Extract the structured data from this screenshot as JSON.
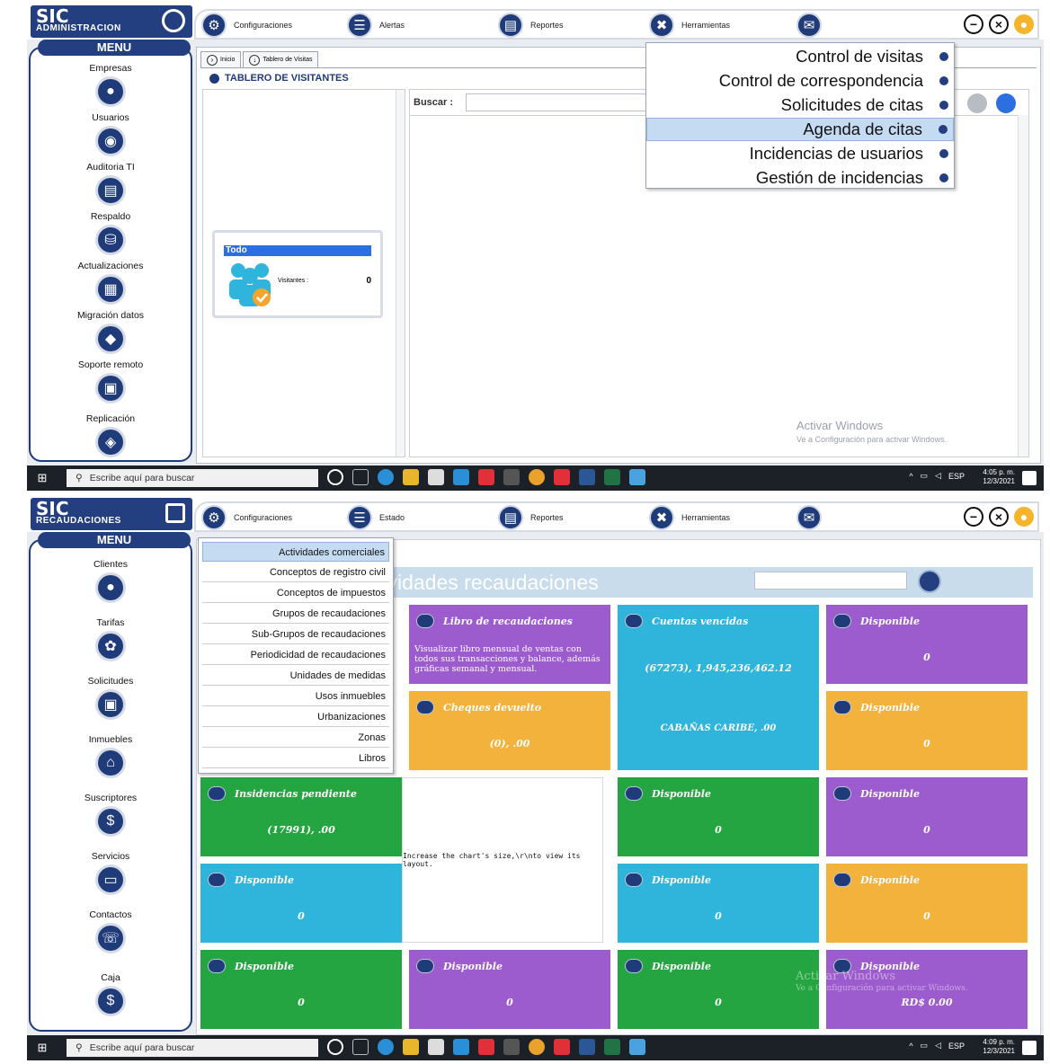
{
  "shot1": {
    "logo": {
      "title": "SIC",
      "subtitle": "ADMINISTRACION"
    },
    "topnav": [
      {
        "label": "Configuraciones",
        "icon": "gear-icon"
      },
      {
        "label": "Alertas",
        "icon": "document-icon"
      },
      {
        "label": "Reportes",
        "icon": "report-icon"
      },
      {
        "label": "Herramientas",
        "icon": "tools-icon"
      },
      {
        "label": "",
        "icon": "mail-icon"
      }
    ],
    "menu_title": "MENU",
    "sidebar": [
      {
        "label": "Empresas",
        "icon": "building-icon"
      },
      {
        "label": "Usuarios",
        "icon": "users-icon"
      },
      {
        "label": "Auditoria TI",
        "icon": "audit-icon"
      },
      {
        "label": "Respaldo",
        "icon": "backup-icon"
      },
      {
        "label": "Actualizaciones",
        "icon": "update-icon"
      },
      {
        "label": "Migración datos",
        "icon": "migration-icon"
      },
      {
        "label": "Soporte remoto",
        "icon": "remote-support-icon"
      },
      {
        "label": "Replicación",
        "icon": "replication-icon"
      }
    ],
    "tabs": [
      "Inicio",
      "Tablero de Visitas"
    ],
    "section_title": "TABLERO DE VISITANTES",
    "card": {
      "header": "Todo",
      "label": "Visitantes :",
      "value": "0"
    },
    "search": {
      "label": "Buscar :",
      "value": ""
    },
    "dropdown": [
      {
        "label": "Control de visitas",
        "selected": false
      },
      {
        "label": "Control de correspondencia",
        "selected": false
      },
      {
        "label": "Solicitudes de citas",
        "selected": false
      },
      {
        "label": "Agenda de citas",
        "selected": true
      },
      {
        "label": "Incidencias de usuarios",
        "selected": false
      },
      {
        "label": "Gestión de incidencias",
        "selected": false
      }
    ],
    "watermark": {
      "line1": "Activar Windows",
      "line2": "Ve a Configuración para activar Windows."
    },
    "taskbar": {
      "search": "Escribe aquí para buscar",
      "lang": "ESP",
      "time": "4:05 p. m.",
      "date": "12/3/2021"
    }
  },
  "shot2": {
    "logo": {
      "title": "SIC",
      "subtitle": "RECAUDACIONES"
    },
    "topnav": [
      {
        "label": "Configuraciones",
        "icon": "gear-icon"
      },
      {
        "label": "Estado",
        "icon": "document-icon"
      },
      {
        "label": "Reportes",
        "icon": "report-icon"
      },
      {
        "label": "Herramientas",
        "icon": "tools-icon"
      },
      {
        "label": "",
        "icon": "mail-icon"
      }
    ],
    "menu_title": "MENU",
    "sidebar": [
      {
        "label": "Clientes",
        "icon": "client-icon"
      },
      {
        "label": "Tarifas",
        "icon": "rates-icon"
      },
      {
        "label": "Solicitudes",
        "icon": "request-icon"
      },
      {
        "label": "Inmuebles",
        "icon": "property-icon"
      },
      {
        "label": "Suscriptores",
        "icon": "subscriber-icon"
      },
      {
        "label": "Servicios",
        "icon": "services-icon"
      },
      {
        "label": "Contactos",
        "icon": "contacts-icon"
      },
      {
        "label": "Caja",
        "icon": "cash-icon"
      }
    ],
    "banner_title": "tividades recaudaciones",
    "dropdown": [
      {
        "label": "Actividades comerciales",
        "selected": true
      },
      {
        "label": "Conceptos de registro civil",
        "selected": false
      },
      {
        "label": "Conceptos de impuestos",
        "selected": false
      },
      {
        "label": "Grupos de recaudaciones",
        "selected": false
      },
      {
        "label": "Sub-Grupos de recaudaciones",
        "selected": false
      },
      {
        "label": "Periodicidad de recaudaciones",
        "selected": false
      },
      {
        "label": "Unidades de medidas",
        "selected": false
      },
      {
        "label": "Usos inmuebles",
        "selected": false
      },
      {
        "label": "Urbanizaciones",
        "selected": false
      },
      {
        "label": "Zonas",
        "selected": false
      },
      {
        "label": "Libros",
        "selected": false
      }
    ],
    "tiles": {
      "libro": {
        "title": "Libro de recaudaciones",
        "desc": "Visualizar libro mensual de ventas con todos sus transacciones y balance, además gráficas semanal y mensual."
      },
      "cuentas": {
        "title": "Cuentas vencidas",
        "value1": "(67273), 1,945,236,462.12",
        "value2": "CABAÑAS CARIBE, .00"
      },
      "disp_r1": {
        "title": "Disponible",
        "value": "0"
      },
      "cheques": {
        "title": "Cheques devuelto",
        "value": "(0), .00"
      },
      "disp_r2": {
        "title": "Disponible",
        "value": "0"
      },
      "insidencias": {
        "title": "Insidencias pendiente",
        "value": "(17991), .00"
      },
      "chart_note": "Increase the chart's size,\\r\\nto view its layout.",
      "disp_r3c": {
        "title": "Disponible",
        "value": "0"
      },
      "disp_r3d": {
        "title": "Disponible",
        "value": "0"
      },
      "disp_r4a": {
        "title": "Disponible",
        "value": "0"
      },
      "disp_r4c": {
        "title": "Disponible",
        "value": "0"
      },
      "disp_r4d": {
        "title": "Disponible",
        "value": "0"
      },
      "disp_r5a": {
        "title": "Disponible",
        "value": "0"
      },
      "disp_r5b": {
        "title": "Disponible",
        "value": "0"
      },
      "disp_r5c": {
        "title": "Disponible",
        "value": "0"
      },
      "disp_r5d": {
        "title": "Disponible",
        "value": "RD$ 0.00"
      }
    },
    "watermark": {
      "line1": "Activar Windows",
      "line2": "Ve a Configuración para activar Windows."
    },
    "taskbar": {
      "search": "Escribe aquí para buscar",
      "lang": "ESP",
      "time": "4:09 p. m.",
      "date": "12/3/2021"
    }
  },
  "colors": {
    "navy": "#243f80",
    "green": "#24a542",
    "purple": "#9d5ccd",
    "blue": "#2fb4dc",
    "orange": "#f2b23b"
  }
}
